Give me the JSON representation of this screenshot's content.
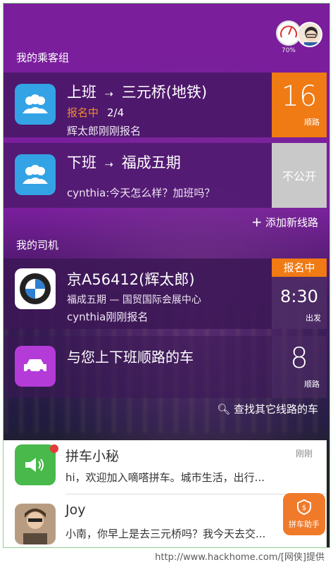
{
  "header": {
    "gauge_percent": "70%"
  },
  "sections": {
    "passenger_group": "我的乘客组",
    "drivers": "我的司机"
  },
  "routes": [
    {
      "from": "上班",
      "to": "三元桥(地铁)",
      "status": "报名中",
      "count": "2/4",
      "note": "辉太郎刚刚报名",
      "badge_num": "16",
      "badge_label": "顺路",
      "badge_color": "#f07a14"
    },
    {
      "from": "下班",
      "to": "福成五期",
      "note": "cynthia:今天怎么样？加班吗？",
      "badge_text": "不公开",
      "badge_color": "#c9c9c9"
    }
  ],
  "add_route": "添加新线路",
  "driver": {
    "plate": "京A56412(辉太郎)",
    "route": "福成五期 — 国贸国际会展中心",
    "note": "cynthia刚刚报名",
    "status_tag": "报名中",
    "time": "8:30",
    "time_label": "出发"
  },
  "match": {
    "label": "与您上下班顺路的车",
    "badge_num": "8",
    "badge_label": "顺路"
  },
  "find_other": "查找其它线路的车",
  "messages": [
    {
      "name": "拼车小秘",
      "text": "hi，欢迎加入嘀嗒拼车。城市生活，出行...",
      "time": "刚刚"
    },
    {
      "name": "Joy",
      "text": "小南，你早上是去三元桥吗？我今天去交..."
    }
  ],
  "helper_label": "拼车助手",
  "footer": "http://www.hackhome.com/[网侠]提供"
}
